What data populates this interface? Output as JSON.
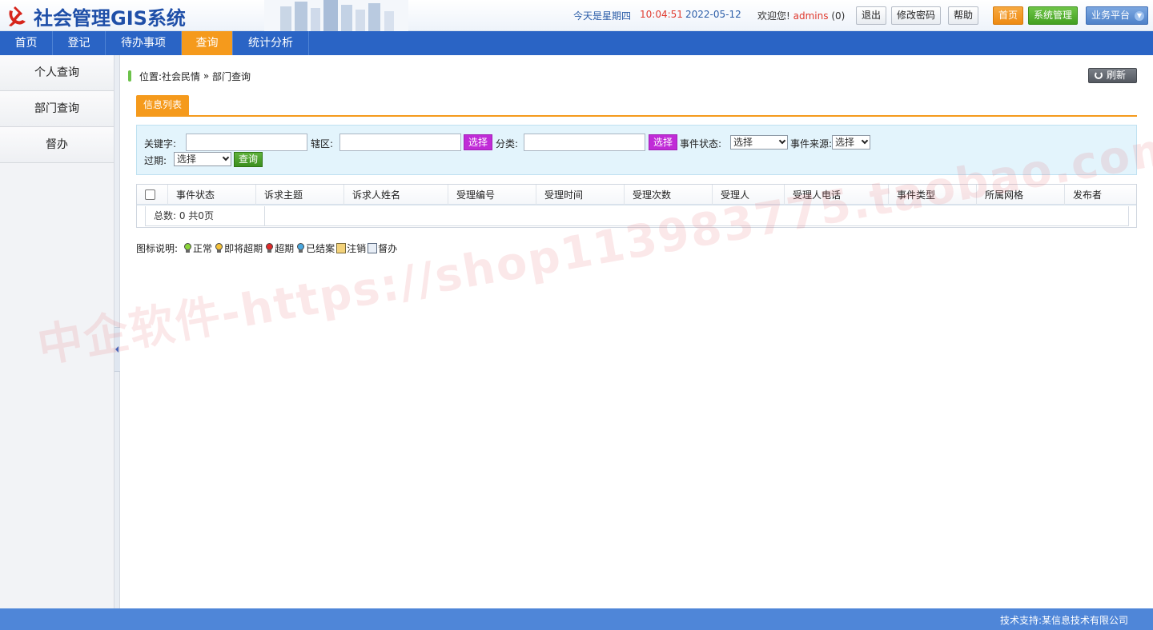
{
  "header": {
    "title": "社会管理GIS系统",
    "day_label": "今天是星期四",
    "time": "10:04:51",
    "date": "2022-05-12",
    "welcome_prefix": "欢迎您!",
    "username": "admins",
    "message_count": "(0)",
    "logout": "退出",
    "change_password": "修改密码",
    "help": "帮助",
    "home": "首页",
    "system_manage": "系统管理",
    "platform": "业务平台"
  },
  "nav": {
    "items": [
      {
        "label": "首页"
      },
      {
        "label": "登记"
      },
      {
        "label": "待办事项"
      },
      {
        "label": "查询",
        "active": true
      },
      {
        "label": "统计分析"
      }
    ]
  },
  "sidebar": {
    "items": [
      {
        "label": "个人查询"
      },
      {
        "label": "部门查询"
      },
      {
        "label": "督办"
      }
    ]
  },
  "breadcrumb": {
    "prefix": "位置:",
    "path1": "社会民情",
    "sep": " » ",
    "path2": "部门查询"
  },
  "refresh_label": "刷新",
  "tab_label": "信息列表",
  "search": {
    "keyword_label": "关键字:",
    "keyword_value": "",
    "district_label": "辖区:",
    "district_value": "",
    "pick_label": "选择",
    "category_label": "分类:",
    "category_value": "",
    "status_label": "事件状态:",
    "status_value": "选择",
    "source_label": "事件来源:",
    "source_value": "选择",
    "expire_label": "过期:",
    "expire_value": "选择",
    "query_label": "查询"
  },
  "table": {
    "columns": [
      "事件状态",
      "诉求主题",
      "诉求人姓名",
      "受理编号",
      "受理时间",
      "受理次数",
      "受理人",
      "受理人电话",
      "事件类型",
      "所属网格",
      "发布者"
    ],
    "total_text": "总数: 0 共0页"
  },
  "legend": {
    "title": "图标说明:",
    "items": [
      {
        "label": "正常",
        "color": "#8bd43a"
      },
      {
        "label": "即将超期",
        "color": "#f5c23a"
      },
      {
        "label": "超期",
        "color": "#e02a2a"
      },
      {
        "label": "已结案",
        "color": "#4aa8e0"
      },
      {
        "label": "注销",
        "icon": "cancel-icon"
      },
      {
        "label": "督办",
        "icon": "supervise-icon"
      }
    ]
  },
  "footer": {
    "text": "技术支持:某信息技术有限公司"
  },
  "watermark": "中企软件-https://shop113983775.taobao.com",
  "colors": {
    "nav_bg": "#2a64c5",
    "active": "#f59a1c",
    "footer_bg": "#4f86d8",
    "pick_btn": "#c02bd7",
    "query_btn": "#3c8f1e"
  }
}
